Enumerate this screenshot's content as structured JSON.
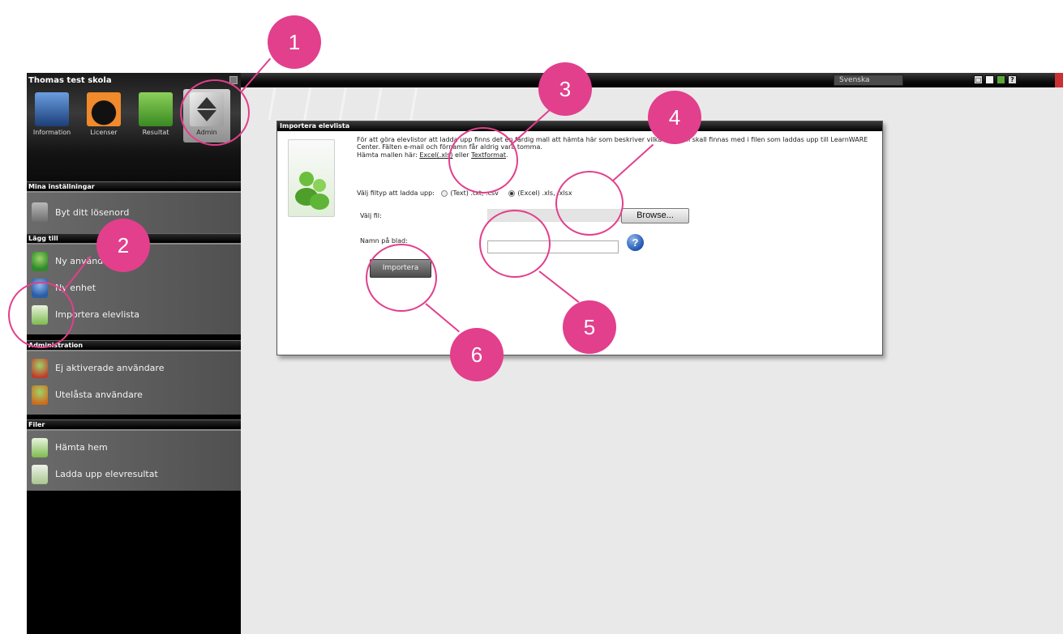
{
  "topbar": {
    "language": "Svenska",
    "icons": [
      "window-icon",
      "copy-icon",
      "green-tile-icon",
      "help-icon"
    ],
    "help_label": "?"
  },
  "sidebar": {
    "school_name": "Thomas test skola",
    "tiles": [
      {
        "label": "Information",
        "icon": "information-icon"
      },
      {
        "label": "Licenser",
        "icon": "license-icon"
      },
      {
        "label": "Resultat",
        "icon": "results-icon"
      },
      {
        "label": "Admin",
        "icon": "admin-icon"
      }
    ],
    "sections": [
      {
        "title": "Mina inställningar",
        "items": [
          {
            "label": "Byt ditt lösenord",
            "icon": "lock-icon"
          }
        ]
      },
      {
        "title": "Lägg till",
        "items": [
          {
            "label": "Ny användare",
            "icon": "add-user-icon"
          },
          {
            "label": "Ny enhet",
            "icon": "add-unit-icon"
          },
          {
            "label": "Importera elevlista",
            "icon": "import-list-icon"
          }
        ]
      },
      {
        "title": "Administration",
        "items": [
          {
            "label": "Ej aktiverade användare",
            "icon": "inactive-user-icon"
          },
          {
            "label": "Utelåsta användare",
            "icon": "locked-user-icon"
          }
        ]
      },
      {
        "title": "Filer",
        "items": [
          {
            "label": "Hämta hem",
            "icon": "download-icon"
          },
          {
            "label": "Ladda upp elevresultat",
            "icon": "upload-results-icon"
          }
        ]
      }
    ]
  },
  "panel": {
    "title": "Importera elevlista",
    "description": "För att göra elevlistor att ladda upp finns det en färdig mall att hämta här som beskriver vilka fält som skall finnas med i filen som laddas upp till LearnWARE Center. Fälten e-mail och förnamn får aldrig vara tomma.",
    "template_prefix": "Hämta mallen här:",
    "template_excel": "Excel(.xls)",
    "template_or": "eller",
    "template_text": "Textformat",
    "filetype_label": "Välj filtyp att ladda upp:",
    "filetype_text": "(Text) .txt, .csv",
    "filetype_excel": "(Excel) .xls, .xlsx",
    "filetype_selected": "excel",
    "file_label": "Välj fil:",
    "browse_label": "Browse...",
    "sheet_label": "Namn på blad:",
    "sheet_value": "",
    "help_label": "?",
    "import_label": "Importera"
  },
  "annotations": {
    "colors": {
      "accent": "#e23f8c"
    },
    "numbers": [
      "1",
      "2",
      "3",
      "4",
      "5",
      "6"
    ]
  }
}
